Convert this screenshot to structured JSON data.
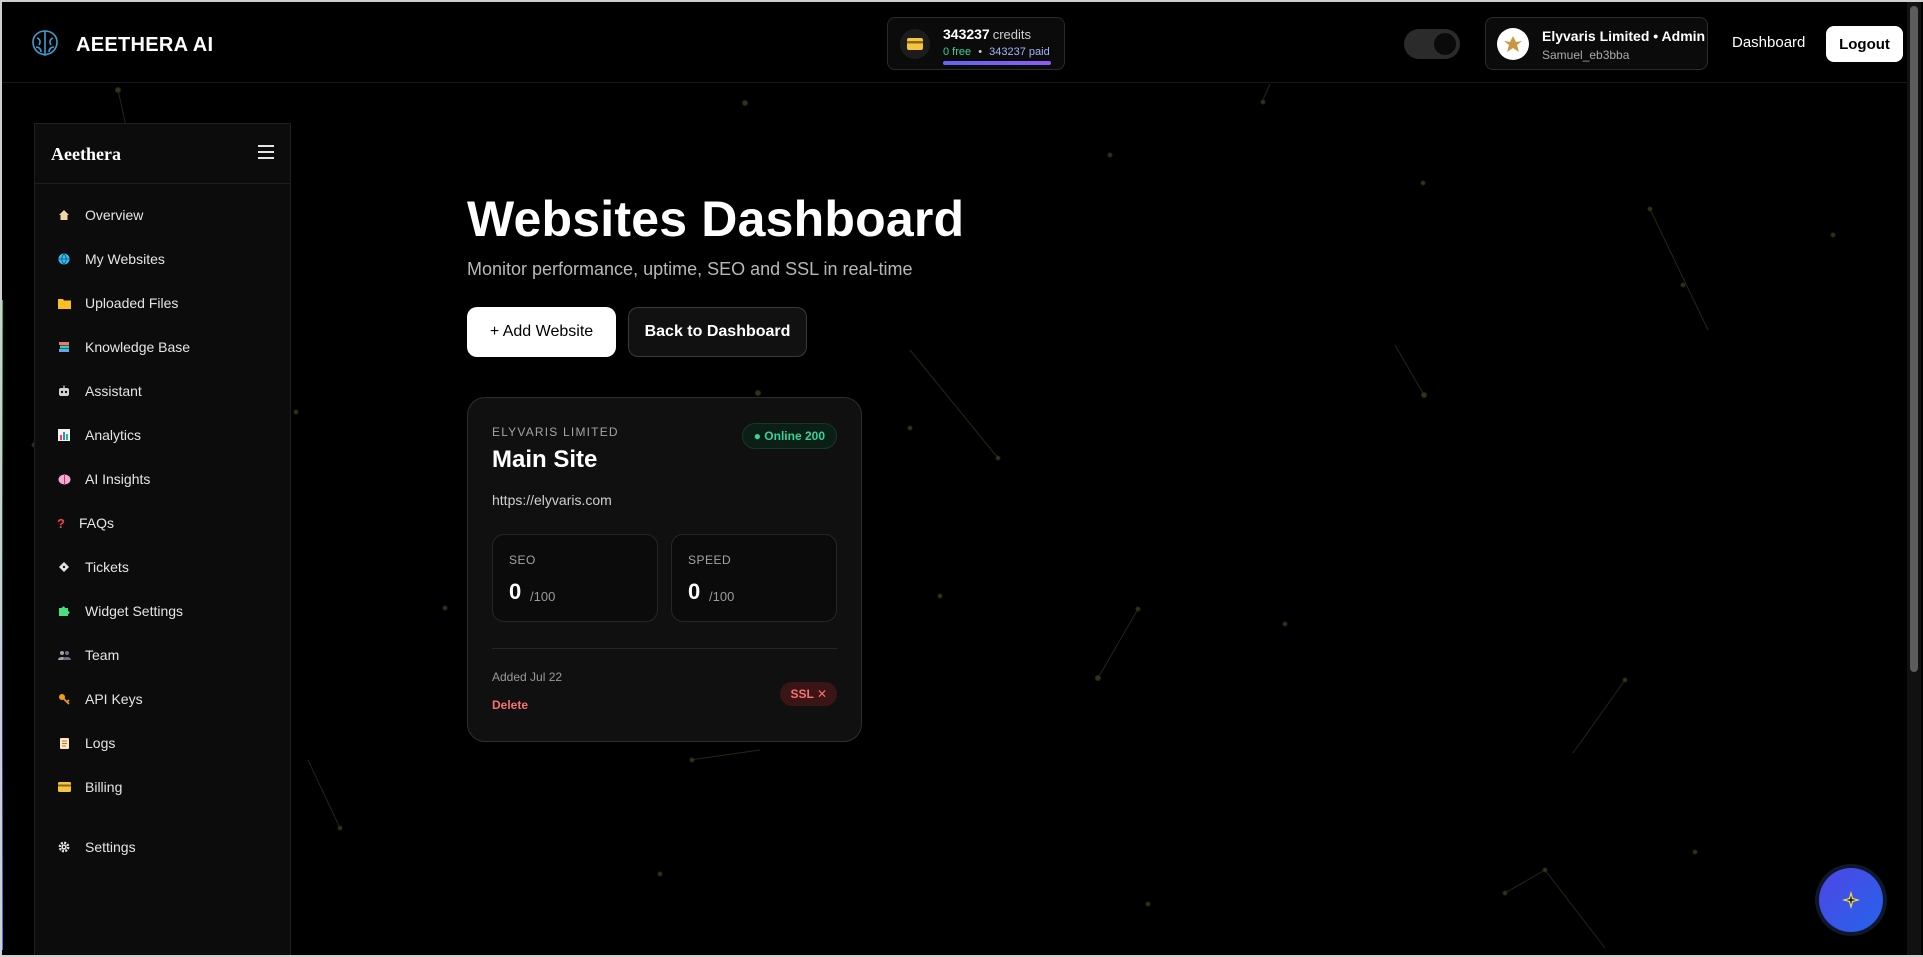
{
  "header": {
    "brand": "AEETHERA AI",
    "credits": {
      "amount": "343237",
      "amount_label": "credits",
      "free": "0 free",
      "separator": "•",
      "paid": "343237 paid",
      "paid_fraction": 1.0
    },
    "theme_toggle_on": true,
    "user": {
      "name": "Elyvaris Limited • Admin",
      "id": "Samuel_eb3bba"
    },
    "nav_dashboard": "Dashboard",
    "logout": "Logout"
  },
  "sidebar": {
    "title": "Aeethera",
    "items": [
      {
        "label": "Overview",
        "icon": "home-icon"
      },
      {
        "label": "My Websites",
        "icon": "globe-icon"
      },
      {
        "label": "Uploaded Files",
        "icon": "folder-icon"
      },
      {
        "label": "Knowledge Base",
        "icon": "books-icon"
      },
      {
        "label": "Assistant",
        "icon": "robot-icon"
      },
      {
        "label": "Analytics",
        "icon": "bar-chart-icon"
      },
      {
        "label": "AI Insights",
        "icon": "brain-icon"
      },
      {
        "label": "FAQs",
        "icon": "question-icon"
      },
      {
        "label": "Tickets",
        "icon": "ticket-icon"
      },
      {
        "label": "Widget Settings",
        "icon": "puzzle-icon"
      },
      {
        "label": "Team",
        "icon": "people-icon"
      },
      {
        "label": "API Keys",
        "icon": "key-icon"
      },
      {
        "label": "Logs",
        "icon": "scroll-icon"
      },
      {
        "label": "Billing",
        "icon": "credit-card-icon"
      },
      {
        "label": "Settings",
        "icon": "gear-icon"
      }
    ]
  },
  "main": {
    "title": "Websites Dashboard",
    "subtitle": "Monitor performance, uptime, SEO and SSL in real-time",
    "add_button": "+ Add Website",
    "back_button": "Back to Dashboard",
    "card": {
      "owner": "ELYVARIS LIMITED",
      "name": "Main Site",
      "status": "● Online 200",
      "url": "https://elyvaris.com",
      "seo_label": "SEO",
      "seo_value": "0",
      "seo_max": "/100",
      "speed_label": "SPEED",
      "speed_value": "0",
      "speed_max": "/100",
      "added": "Added Jul 22",
      "delete": "Delete",
      "ssl": "SSL ✕"
    }
  },
  "colors": {
    "background": "#000000",
    "accent": "#6366f1",
    "online": "#34d399",
    "danger": "#f87171"
  }
}
